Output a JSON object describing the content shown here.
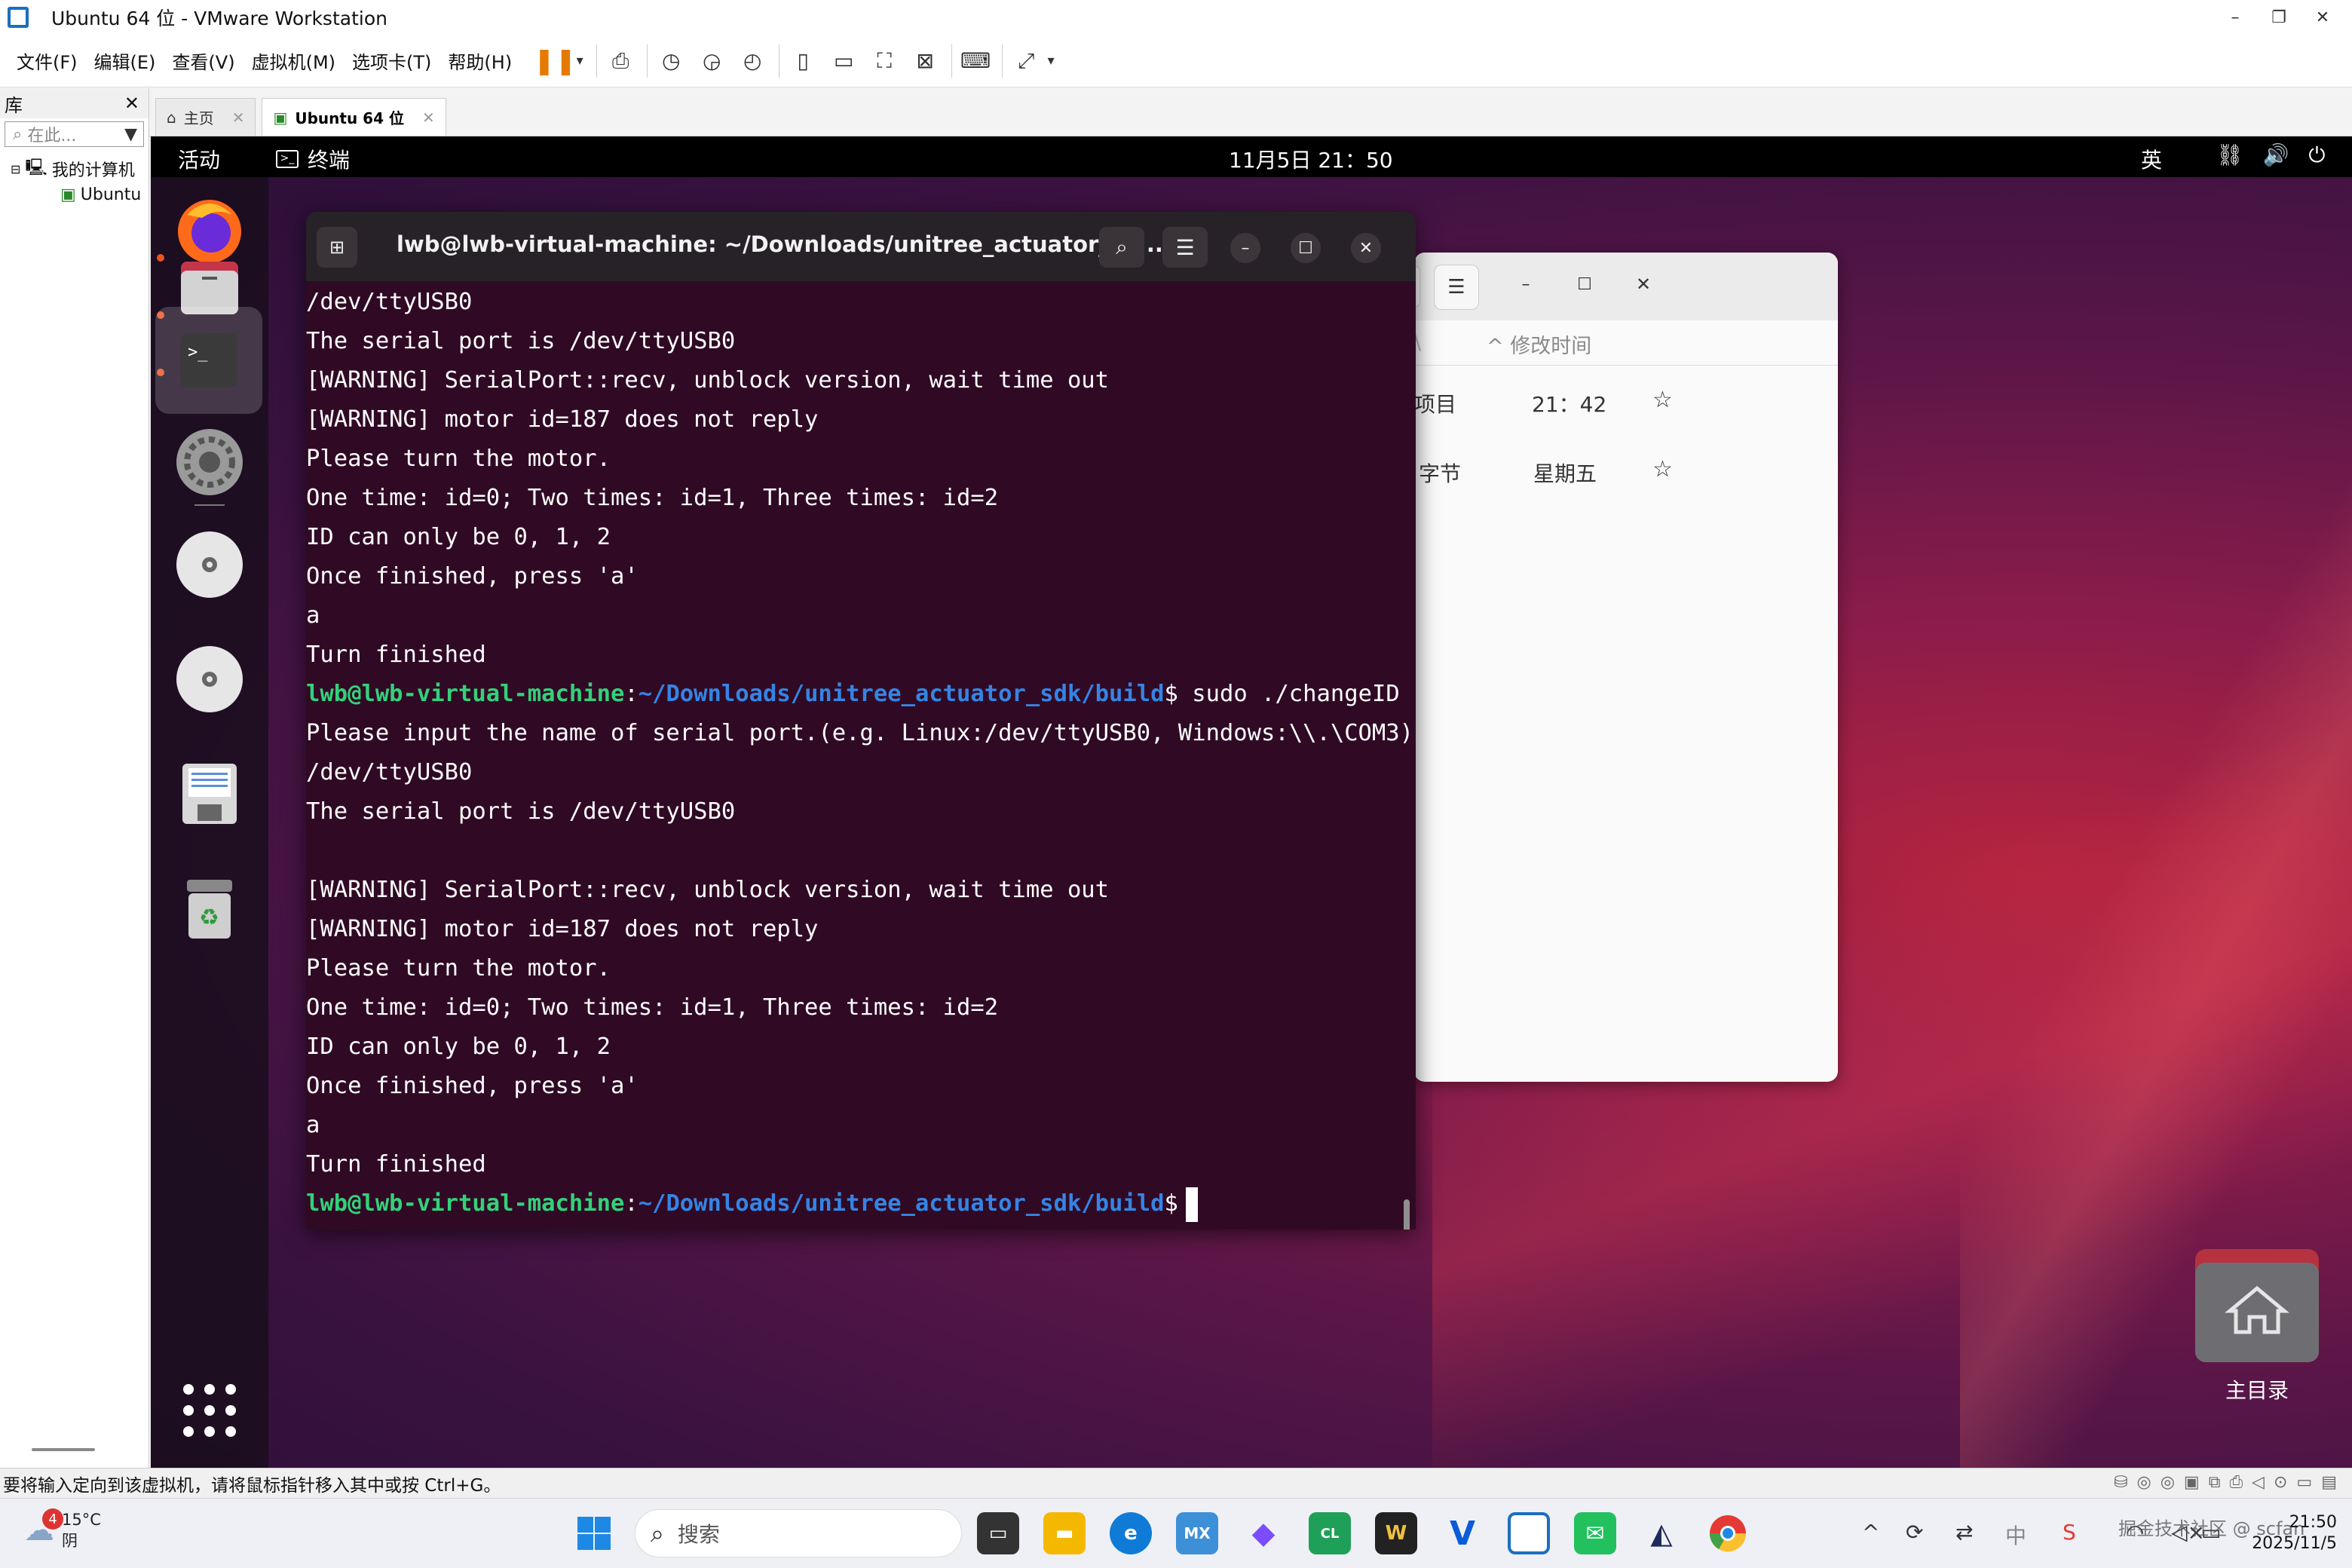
{
  "window": {
    "title": "Ubuntu 64 位 - VMware Workstation",
    "controls": [
      "–",
      "❐",
      "✕"
    ]
  },
  "menu": [
    "文件(F)",
    "编辑(E)",
    "查看(V)",
    "虚拟机(M)",
    "选项卡(T)",
    "帮助(H)"
  ],
  "library": {
    "title": "库",
    "close": "✕",
    "search_placeholder": "在此...",
    "tree": [
      "我的计算机",
      "Ubuntu"
    ]
  },
  "tabs": [
    {
      "label": "主页",
      "close": "✕"
    },
    {
      "label": "Ubuntu 64 位",
      "close": "✕"
    }
  ],
  "ubuntu_topbar": {
    "activities": "活动",
    "app": "终端",
    "clock": "11月5日  21：50",
    "ime": "英"
  },
  "terminal": {
    "title": "lwb@lwb-virtual-machine: ~/Downloads/unitree_actuator_sd...",
    "prompt_user": "lwb@lwb-virtual-machine",
    "prompt_sep": ":",
    "prompt_path": "~/Downloads/unitree_actuator_sdk/build",
    "prompt_dollar": "$",
    "command": " sudo ./changeID",
    "lines_before": [
      "/dev/ttyUSB0",
      "The serial port is /dev/ttyUSB0",
      "[WARNING] SerialPort::recv, unblock version, wait time out",
      "[WARNING] motor id=187 does not reply",
      "Please turn the motor.",
      "One time: id=0; Two times: id=1, Three times: id=2",
      "ID can only be 0, 1, 2",
      "Once finished, press 'a'",
      "a",
      "Turn finished"
    ],
    "lines_after": [
      "Please input the name of serial port.(e.g. Linux:/dev/ttyUSB0, Windows:\\\\.\\COM3)",
      "/dev/ttyUSB0",
      "The serial port is /dev/ttyUSB0",
      "",
      "[WARNING] SerialPort::recv, unblock version, wait time out",
      "[WARNING] motor id=187 does not reply",
      "Please turn the motor.",
      "One time: id=0; Two times: id=1, Three times: id=2",
      "ID can only be 0, 1, 2",
      "Once finished, press 'a'",
      "a",
      "Turn finished"
    ]
  },
  "file_manager": {
    "column_header": "修改时间",
    "rows": [
      {
        "size": "项目",
        "modified": "21：42"
      },
      {
        "size": "字节",
        "modified": "星期五"
      }
    ]
  },
  "desktop": {
    "home_label": "主目录"
  },
  "statusbar": {
    "hint": "要将输入定向到该虚拟机，请将鼠标指针移入其中或按 Ctrl+G。"
  },
  "taskbar": {
    "weather_temp": "15°C",
    "weather_desc": "阴",
    "weather_badge": "4",
    "search_placeholder": "搜索",
    "ime_tray": "中",
    "time": "21:50",
    "date": "2025/11/5",
    "watermark": "掘金技术社区 @ scfan"
  },
  "colors": {
    "terminal_bg": "#300a24",
    "prompt_user": "#33d17a",
    "prompt_path": "#3584e4",
    "ubuntu_accent": "#e95420"
  }
}
